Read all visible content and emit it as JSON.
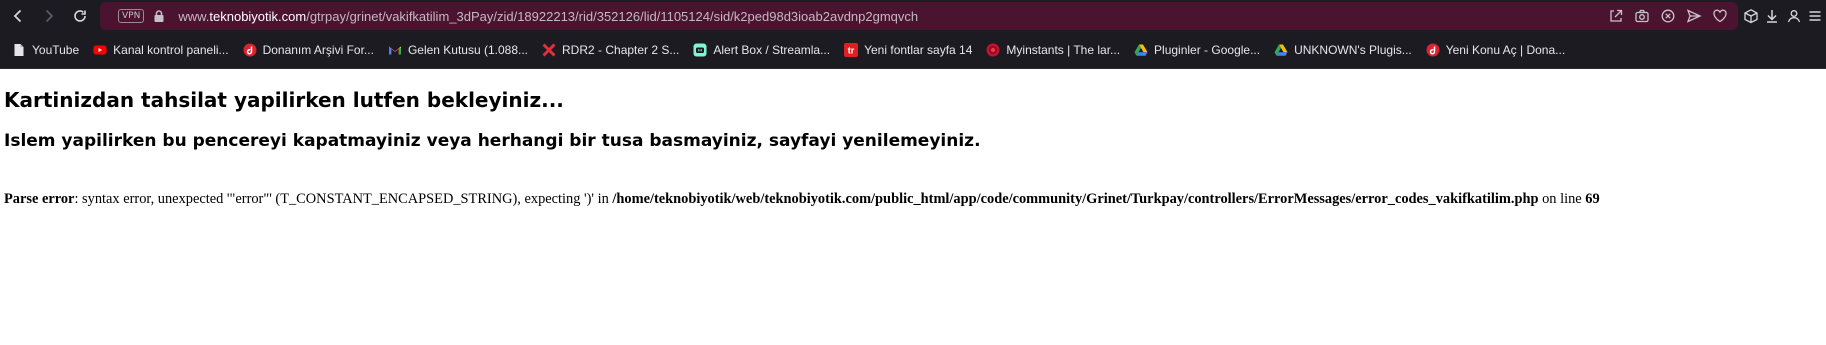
{
  "browser": {
    "url": {
      "vpn_label": "VPN",
      "prefix": "www.",
      "domain": "teknobiyotik.com",
      "path": "/gtrpay/grinet/vakifkatilim_3dPay/zid/18922213/rid/352126/lid/1105124/sid/k2ped98d3ioab2avdnp2gmqvch"
    },
    "nav_icons": [
      "back-icon",
      "forward-icon",
      "reload-icon"
    ],
    "url_action_icons": [
      "share-icon",
      "camera-icon",
      "close-circle-icon",
      "send-icon",
      "heart-icon"
    ],
    "toolbar_icons": [
      "box-icon",
      "download-icon",
      "user-icon",
      "menu-icon"
    ],
    "colors": {
      "chrome_bg": "#1c1b22",
      "urlbar_bg": "#4a1330"
    }
  },
  "bookmarks": [
    {
      "label": "YouTube",
      "icon": "file-icon"
    },
    {
      "label": "Kanal kontrol paneli...",
      "icon": "youtube-icon"
    },
    {
      "label": "Donanım Arşivi For...",
      "icon": "donanim-arsivi-icon"
    },
    {
      "label": "Gelen Kutusu (1.088...",
      "icon": "gmail-icon"
    },
    {
      "label": "RDR2 - Chapter 2 S...",
      "icon": "rdr2-icon"
    },
    {
      "label": "Alert Box / Streamla...",
      "icon": "streamlabs-icon"
    },
    {
      "label": "Yeni fontlar sayfa 14",
      "icon": "tr-icon"
    },
    {
      "label": "Myinstants | The lar...",
      "icon": "myinstants-icon"
    },
    {
      "label": "Pluginler - Google...",
      "icon": "google-drive-icon"
    },
    {
      "label": "UNKNOWN's Plugis...",
      "icon": "google-drive-icon"
    },
    {
      "label": "Yeni Konu Aç | Dona...",
      "icon": "donanim-arsivi-icon"
    }
  ],
  "page": {
    "heading_wait": "Kartinizdan tahsilat yapilirken lutfen bekleyiniz...",
    "heading_warning": "Islem yapilirken bu pencereyi kapatmayiniz veya herhangi bir tusa basmayiniz, sayfayi yenilemeyiniz.",
    "error": {
      "label": "Parse error",
      "message": ": syntax error, unexpected '\"error\"' (T_CONSTANT_ENCAPSED_STRING), expecting ')' in ",
      "file": "/home/teknobiyotik/web/teknobiyotik.com/public_html/app/code/community/Grinet/Turkpay/controllers/ErrorMessages/error_codes_vakifkatilim.php",
      "line_text": " on line ",
      "line_number": "69"
    }
  }
}
